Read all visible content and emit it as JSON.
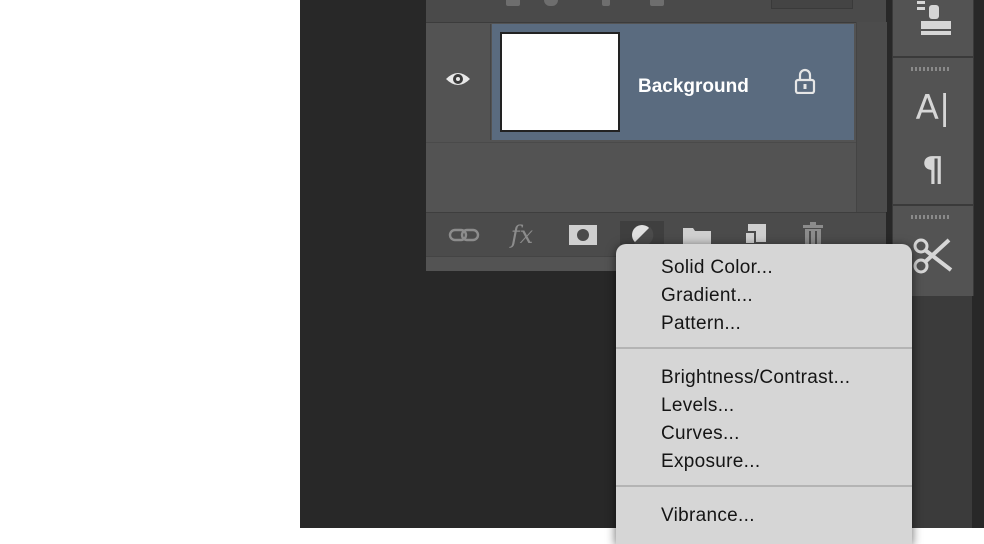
{
  "layers_panel": {
    "layer": {
      "name": "Background",
      "visibility_icon": "eye-icon",
      "lock_icon": "lock-icon",
      "thumbnail_color": "#ffffff"
    },
    "bottom_toolbar": [
      {
        "icon": "link-icon"
      },
      {
        "icon": "fx-icon",
        "label": "fx"
      },
      {
        "icon": "mask-icon"
      },
      {
        "icon": "adjustment-layer-icon"
      },
      {
        "icon": "folder-icon"
      },
      {
        "icon": "new-layer-icon"
      },
      {
        "icon": "trash-icon"
      }
    ],
    "selected_color": "#5a6b7f"
  },
  "tool_strip": {
    "tools": [
      {
        "icon": "clone-source-icon"
      },
      {
        "icon": "character-icon",
        "label": "A|"
      },
      {
        "icon": "paragraph-icon",
        "label": "¶"
      },
      {
        "icon": "tool-presets-icon"
      }
    ]
  },
  "adjustment_menu": {
    "items": [
      "Solid Color...",
      "Gradient...",
      "Pattern...",
      "Brightness/Contrast...",
      "Levels...",
      "Curves...",
      "Exposure...",
      "Vibrance..."
    ]
  }
}
